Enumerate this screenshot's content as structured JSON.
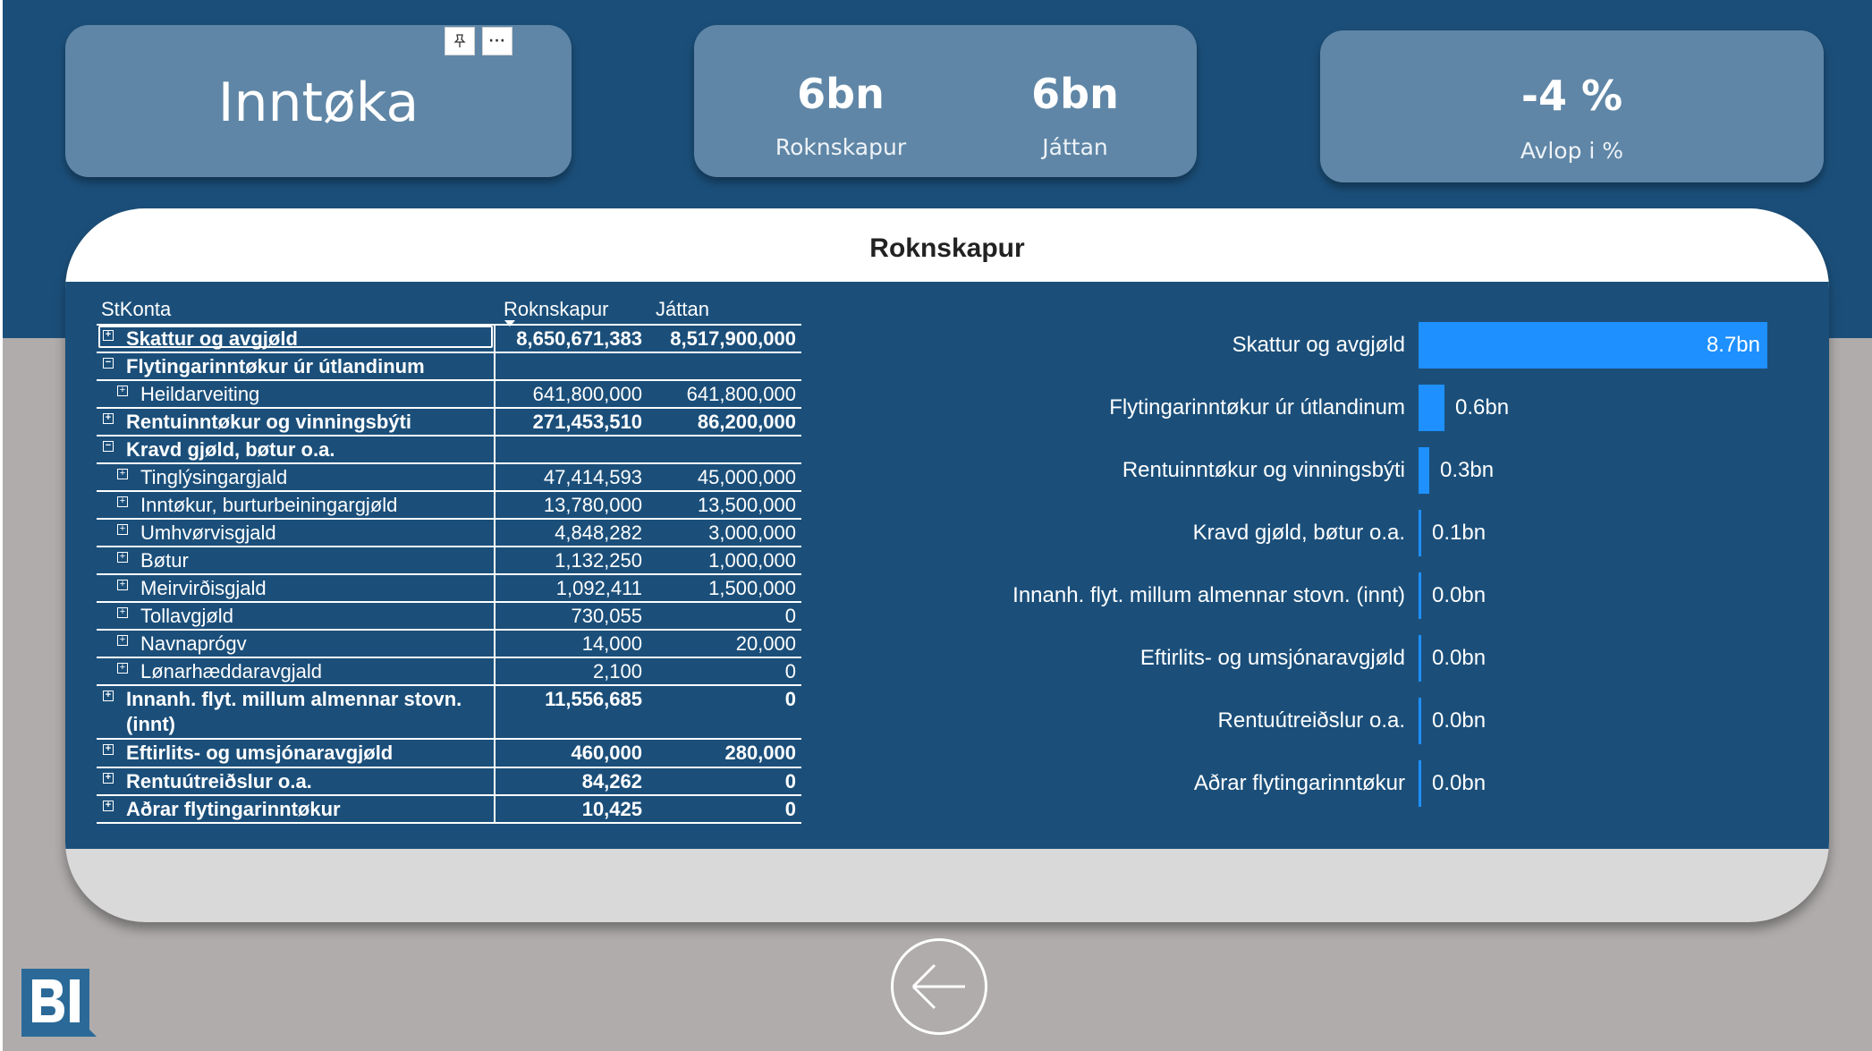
{
  "colors": {
    "background_top": "#1b4f7a",
    "background_bottom": "#b0acac",
    "card": "#5f86a6",
    "bar": "#1e90ff"
  },
  "cards": {
    "title": "Inntøka",
    "kpi_rokn_value": "6bn",
    "kpi_rokn_label": "Roknskapur",
    "kpi_jattan_value": "6bn",
    "kpi_jattan_label": "Játtan",
    "kpi_avlop_value": "-4 %",
    "kpi_avlop_label": "Avlop i %"
  },
  "panel": {
    "title": "Roknskapur"
  },
  "table": {
    "headers": {
      "name": "StKonta",
      "rokn": "Roknskapur",
      "jattan": "Játtan"
    },
    "rows": [
      {
        "name": "Skattur og avgjøld",
        "rokn": "8,650,671,383",
        "jattan": "8,517,900,000",
        "bold": true,
        "level": 0,
        "expander": "⊞"
      },
      {
        "name": "Flytingarinntøkur úr útlandinum",
        "rokn": "",
        "jattan": "",
        "bold": true,
        "level": 0,
        "expander": "⊟"
      },
      {
        "name": "Heildarveiting",
        "rokn": "641,800,000",
        "jattan": "641,800,000",
        "bold": false,
        "level": 1,
        "expander": "⊞"
      },
      {
        "name": "Rentuinntøkur og vinningsbýti",
        "rokn": "271,453,510",
        "jattan": "86,200,000",
        "bold": true,
        "level": 0,
        "expander": "⊞"
      },
      {
        "name": "Kravd gjøld, bøtur o.a.",
        "rokn": "",
        "jattan": "",
        "bold": true,
        "level": 0,
        "expander": "⊟"
      },
      {
        "name": "Tinglýsingargjald",
        "rokn": "47,414,593",
        "jattan": "45,000,000",
        "bold": false,
        "level": 1,
        "expander": "⊞"
      },
      {
        "name": "Inntøkur, burturbeiningargjøld",
        "rokn": "13,780,000",
        "jattan": "13,500,000",
        "bold": false,
        "level": 1,
        "expander": "⊞"
      },
      {
        "name": "Umhvørvisgjald",
        "rokn": "4,848,282",
        "jattan": "3,000,000",
        "bold": false,
        "level": 1,
        "expander": "⊞"
      },
      {
        "name": "Bøtur",
        "rokn": "1,132,250",
        "jattan": "1,000,000",
        "bold": false,
        "level": 1,
        "expander": "⊞"
      },
      {
        "name": "Meirvirðisgjald",
        "rokn": "1,092,411",
        "jattan": "1,500,000",
        "bold": false,
        "level": 1,
        "expander": "⊞"
      },
      {
        "name": "Tollavgjøld",
        "rokn": "730,055",
        "jattan": "0",
        "bold": false,
        "level": 1,
        "expander": "⊞"
      },
      {
        "name": "Navnaprógv",
        "rokn": "14,000",
        "jattan": "20,000",
        "bold": false,
        "level": 1,
        "expander": "⊞"
      },
      {
        "name": "Lønarhæddaravgjald",
        "rokn": "2,100",
        "jattan": "0",
        "bold": false,
        "level": 1,
        "expander": "⊞"
      },
      {
        "name": "Innanh. flyt. millum almennar stovn.",
        "name2": "(innt)",
        "rokn": "11,556,685",
        "jattan": "0",
        "bold": true,
        "level": 0,
        "expander": "⊞"
      },
      {
        "name": "Eftirlits- og umsjónaravgjøld",
        "rokn": "460,000",
        "jattan": "280,000",
        "bold": true,
        "level": 0,
        "expander": "⊞"
      },
      {
        "name": "Rentuútreiðslur o.a.",
        "rokn": "84,262",
        "jattan": "0",
        "bold": true,
        "level": 0,
        "expander": "⊞"
      },
      {
        "name": "Aðrar flytingarinntøkur",
        "rokn": "10,425",
        "jattan": "0",
        "bold": true,
        "level": 0,
        "expander": "⊞"
      }
    ]
  },
  "chart_data": {
    "type": "bar",
    "orientation": "horizontal",
    "categories": [
      "Skattur og avgjøld",
      "Flytingarinntøkur úr útlandinum",
      "Rentuinntøkur og vinningsbýti",
      "Kravd gjøld, bøtur o.a.",
      "Innanh. flyt. millum almennar stovn. (innt)",
      "Eftirlits- og umsjónaravgjøld",
      "Rentuútreiðslur o.a.",
      "Aðrar flytingarinntøkur"
    ],
    "values": [
      8.65,
      0.64,
      0.27,
      0.07,
      0.01,
      0.0005,
      0.0001,
      1e-05
    ],
    "value_labels": [
      "8.7bn",
      "0.6bn",
      "0.3bn",
      "0.1bn",
      "0.0bn",
      "0.0bn",
      "0.0bn",
      "0.0bn"
    ],
    "grid": false
  },
  "icons": {
    "pin": "pin-icon",
    "more": "more-options-icon",
    "back": "back-arrow-icon",
    "logo": "bi-logo"
  }
}
